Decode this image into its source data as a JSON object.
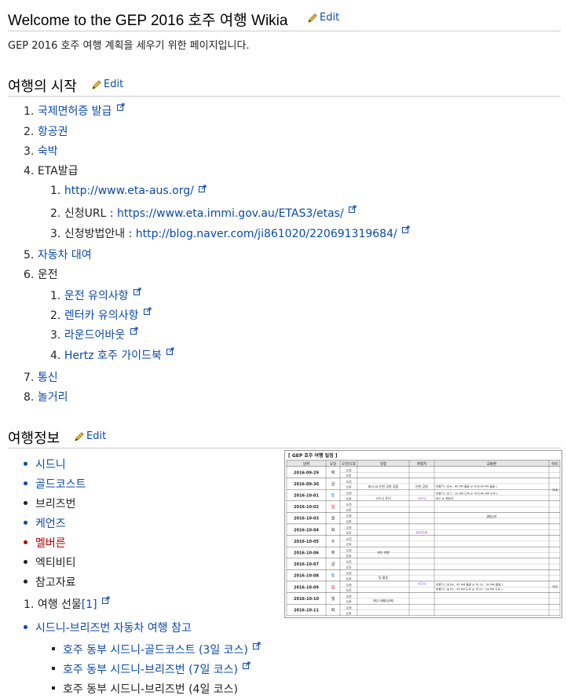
{
  "page": {
    "title": "Welcome to the GEP 2016 호주 여행 Wikia",
    "edit_label": "Edit",
    "intro": "GEP 2016 호주 여행 계획을 세우기 위한 페이지입니다."
  },
  "section1": {
    "heading": "여행의 시작",
    "items": [
      {
        "n": "1.",
        "text": "국제면허증 발급"
      },
      {
        "n": "2.",
        "text": "항공권"
      },
      {
        "n": "3.",
        "text": "숙박"
      },
      {
        "n": "4.",
        "text": "ETA발급"
      },
      {
        "n": "5.",
        "text": "자동차 대여"
      },
      {
        "n": "6.",
        "text": "운전"
      },
      {
        "n": "7.",
        "text": "통신"
      },
      {
        "n": "8.",
        "text": "놀거리"
      }
    ],
    "eta_sub": [
      {
        "n": "1.",
        "prefix": "",
        "link": "http://www.eta-aus.org/"
      },
      {
        "n": "2.",
        "prefix": "신청URL : ",
        "link": "https://www.eta.immi.gov.au/ETAS3/etas/"
      },
      {
        "n": "3.",
        "prefix": "신청방법안내 : ",
        "link": "http://blog.naver.com/ji861020/220691319684/"
      }
    ],
    "drive_sub": [
      {
        "n": "1.",
        "text": "운전 유의사항"
      },
      {
        "n": "2.",
        "text": "렌터카 유의사항"
      },
      {
        "n": "3.",
        "text": "라운드어바웃"
      },
      {
        "n": "4.",
        "text": "Hertz 호주 가이드북"
      }
    ]
  },
  "section2": {
    "heading": "여행정보",
    "cities": [
      "시드니",
      "골드코스트",
      "브리즈번",
      "케언즈",
      "멜버른",
      "엑티비티",
      "참고자료"
    ],
    "gift": {
      "n": "1.",
      "text": "여행 선물",
      "ref": "[1]"
    },
    "drive_ref": "시드니-브리즈번 자동차 여행 참고",
    "drive_courses": [
      "호주 동부 시드니-골드코스트 (3일 코스)",
      "호주 동부 시드니-브리즈번 (7일 코스)",
      "호주 동부 시드니-브리즈번 (4일 코스)"
    ]
  },
  "schedule": {
    "caption": "[ GEP 호주 여행 일정 ]",
    "headers": [
      "날짜",
      "요일",
      "오전/오후",
      "일정",
      "여행지",
      "교통편",
      "숙박"
    ],
    "dates": [
      "2016-09-29",
      "2016-09-30",
      "2016-10-01",
      "2016-10-02",
      "2016-10-03",
      "2016-10-04",
      "2016-10-05",
      "2016-10-06",
      "2016-10-07",
      "2016-10-08",
      "2016-10-09",
      "2016-10-10",
      "2016-10-11"
    ],
    "days": [
      "목",
      "금",
      "토",
      "일",
      "월",
      "화",
      "수",
      "목",
      "금",
      "토",
      "일",
      "월",
      "화"
    ],
    "ampm": [
      "오전",
      "오후"
    ],
    "notes": {
      "meet": "회사 or 인천 공항 집합",
      "incheon": "인천 공항",
      "sydney_tour": "시드니 투어",
      "sydney": "시드니",
      "brisbane": "브리즈번",
      "free1": "개인 여행",
      "team": "팀 활동",
      "free2": "개인 여행(선택)",
      "rental": "렌트카",
      "bus": "버스 or 렌트카",
      "flight1": "비행기 ( 대 6 : 45 PM 출발 or 아 8:00 PM 출발 )",
      "flight2": "비행기 ( 대 7 : 15 AM 도착 or 아 6:40 AM 도착 )",
      "flight3": "비행기 ( 대 08 : 45 AM 출발 or 아 10 : 30 AM 출발 )",
      "flight4": "비행기 ( 대 05 : 45 PM 도착 or 아 07 : 00 PM 도착 )",
      "stay": "기내"
    }
  },
  "colors": {
    "link": "#0b4aa8",
    "redlink": "#ba0000",
    "rule": "#c8ccd1"
  }
}
